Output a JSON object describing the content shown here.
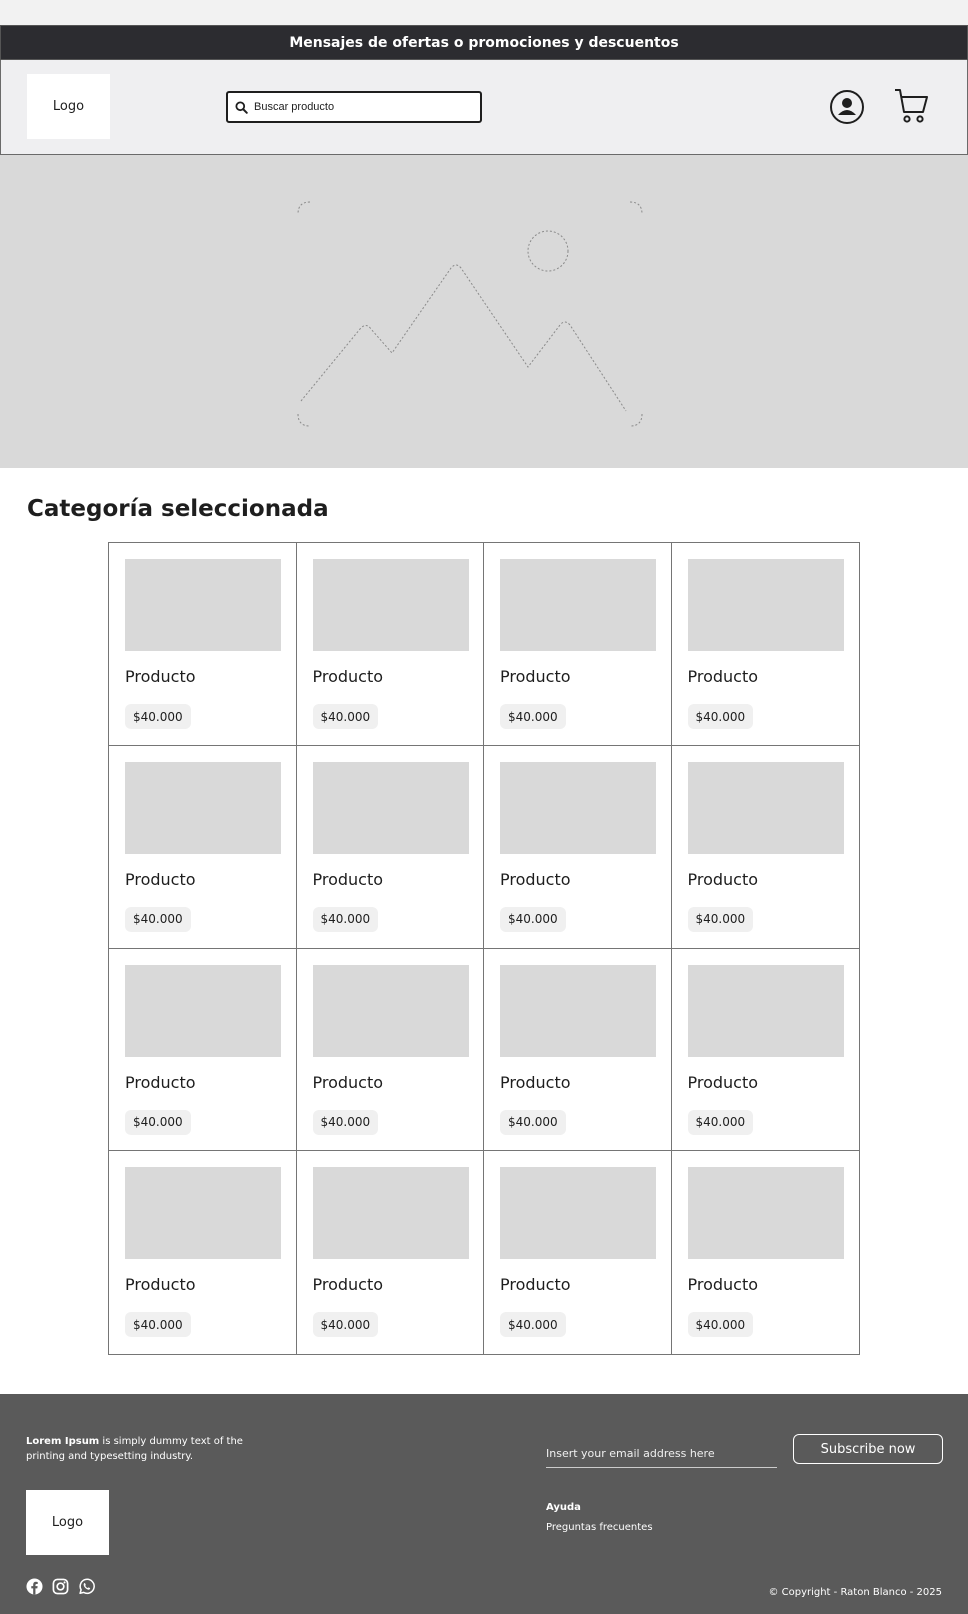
{
  "promo_bar": {
    "text": "Mensajes de ofertas o promociones y descuentos"
  },
  "header": {
    "logo": "Logo",
    "search_placeholder": "Buscar producto",
    "icons": [
      "search-icon",
      "user-icon",
      "cart-icon"
    ]
  },
  "hero": {
    "icon": "image-placeholder-icon"
  },
  "category": {
    "title": "Categoría seleccionada"
  },
  "products": [
    {
      "name": "Producto",
      "price": "$40.000"
    },
    {
      "name": "Producto",
      "price": "$40.000"
    },
    {
      "name": "Producto",
      "price": "$40.000"
    },
    {
      "name": "Producto",
      "price": "$40.000"
    },
    {
      "name": "Producto",
      "price": "$40.000"
    },
    {
      "name": "Producto",
      "price": "$40.000"
    },
    {
      "name": "Producto",
      "price": "$40.000"
    },
    {
      "name": "Producto",
      "price": "$40.000"
    },
    {
      "name": "Producto",
      "price": "$40.000"
    },
    {
      "name": "Producto",
      "price": "$40.000"
    },
    {
      "name": "Producto",
      "price": "$40.000"
    },
    {
      "name": "Producto",
      "price": "$40.000"
    },
    {
      "name": "Producto",
      "price": "$40.000"
    },
    {
      "name": "Producto",
      "price": "$40.000"
    },
    {
      "name": "Producto",
      "price": "$40.000"
    },
    {
      "name": "Producto",
      "price": "$40.000"
    }
  ],
  "footer": {
    "desc_bold": "Lorem Ipsum",
    "desc_rest": " is simply dummy text of the printing and typesetting industry.",
    "logo": "Logo",
    "email_placeholder": "Insert your email address here",
    "subscribe_label": "Subscribe now",
    "help_title": "Ayuda",
    "help_link": "Preguntas frecuentes",
    "copyright": "© Copyright - Raton Blanco - 2025",
    "social_icons": [
      "facebook-icon",
      "instagram-icon",
      "whatsapp-icon"
    ]
  },
  "colors": {
    "promo_bg": "#2c2c30",
    "header_bg": "#efeff1",
    "placeholder_gray": "#d9d9d9",
    "footer_bg": "#5a5a5a",
    "price_bg": "#f0f0f0"
  }
}
